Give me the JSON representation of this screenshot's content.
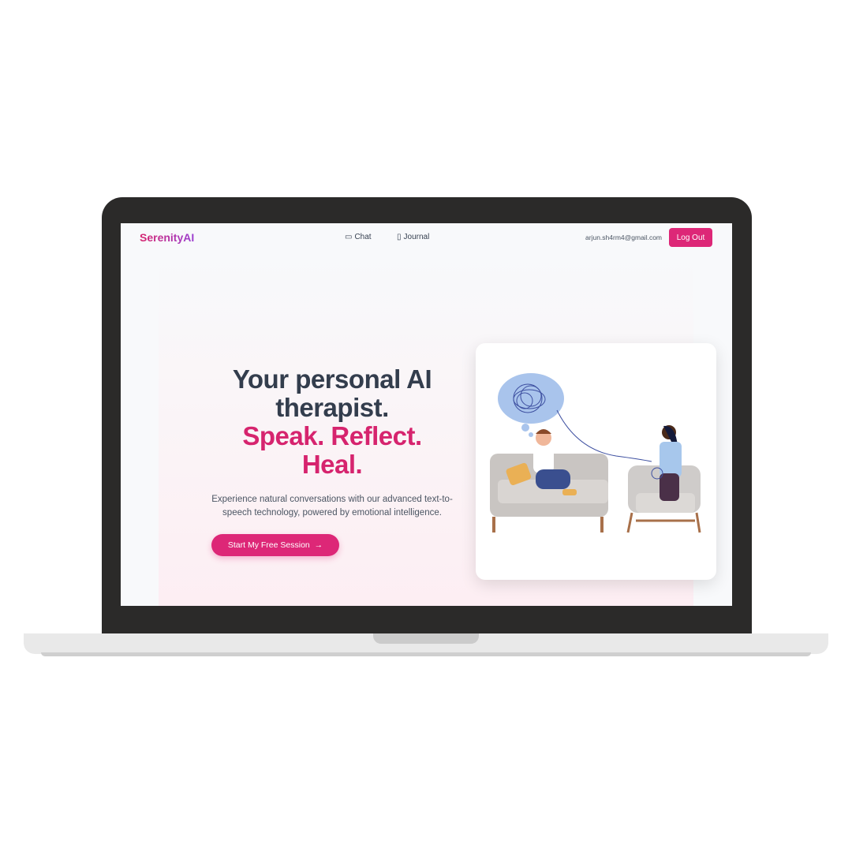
{
  "nav": {
    "logo": "SerenityAI",
    "links": [
      {
        "label": "Chat",
        "icon": "chat-bubble-icon"
      },
      {
        "label": "Journal",
        "icon": "book-open-icon"
      }
    ],
    "email": "arjun.sh4rm4@gmail.com",
    "logout": "Log Out"
  },
  "hero": {
    "title_line1": "Your personal AI",
    "title_line2": "therapist.",
    "accent_line1": "Speak. Reflect.",
    "accent_line2": "Heal.",
    "subtitle": "Experience natural conversations with our advanced text-to-speech technology, powered by emotional intelligence.",
    "cta": "Start My Free Session",
    "cta_icon": "arrow-right-icon"
  },
  "colors": {
    "accent": "#dd2777",
    "heading": "#333d4d",
    "bezel": "#2b2a29"
  }
}
